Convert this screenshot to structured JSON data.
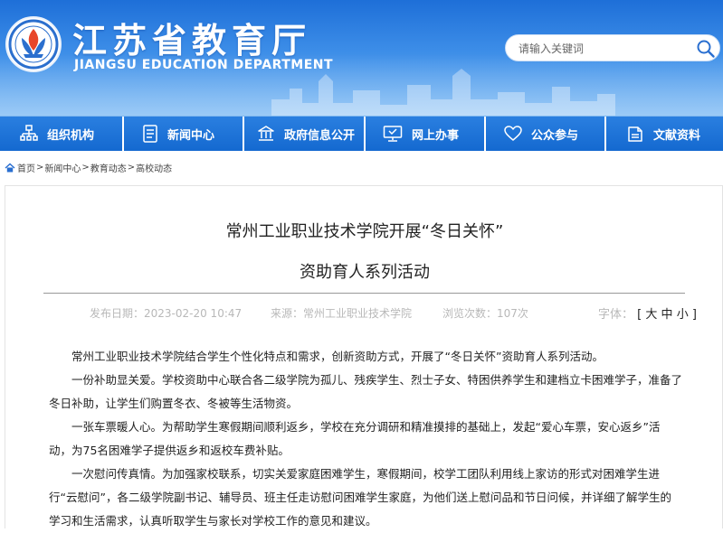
{
  "header": {
    "title": "江苏省教育厅",
    "subtitle": "JIANGSU EDUCATION DEPARTMENT",
    "search_placeholder": "请输入关键词"
  },
  "nav": {
    "items": [
      {
        "label": "组织机构",
        "icon": "org-chart-icon"
      },
      {
        "label": "新闻中心",
        "icon": "document-icon"
      },
      {
        "label": "政府信息公开",
        "icon": "government-icon"
      },
      {
        "label": "网上办事",
        "icon": "monitor-icon"
      },
      {
        "label": "公众参与",
        "icon": "heart-icon"
      },
      {
        "label": "文献资料",
        "icon": "book-icon"
      }
    ]
  },
  "breadcrumb": {
    "items": [
      "首页",
      "新闻中心",
      "教育动态",
      "高校动态"
    ],
    "separator": ">"
  },
  "article": {
    "title_line1": "常州工业职业技术学院开展“冬日关怀”",
    "title_line2": "资助育人系列活动",
    "publish_date": "发布日期：2023-02-20 10:47",
    "source": "来源：常州工业职业技术学院",
    "views": "浏览次数：107次",
    "font_label": "字体：",
    "font_open": "[",
    "font_large": "大",
    "font_medium": "中",
    "font_small": "小",
    "font_close": "]",
    "paragraphs": [
      "常州工业职业技术学院结合学生个性化特点和需求，创新资助方式，开展了“冬日关怀”资助育人系列活动。",
      "一份补助显关爱。学校资助中心联合各二级学院为孤儿、残疾学生、烈士子女、特困供养学生和建档立卡困难学子，准备了冬日补助，让学生们购置冬衣、冬被等生活物资。",
      "一张车票暖人心。为帮助学生寒假期间顺利返乡，学校在充分调研和精准摸排的基础上，发起“爱心车票，安心返乡”活动，为75名困难学子提供返乡和返校车费补贴。",
      "一次慰问传真情。为加强家校联系，切实关爱家庭困难学生，寒假期间，校学工团队利用线上家访的形式对困难学生进行“云慰问”，各二级学院副书记、辅导员、班主任走访慰问困难学生家庭，为他们送上慰问品和节日问候，并详细了解学生的学习和生活需求，认真听取学生与家长对学校工作的意见和建议。"
    ]
  },
  "colors": {
    "header_blue": "#1e6fd8",
    "nav_blue": "#1469d0",
    "meta_gray": "#b8b8b8"
  }
}
